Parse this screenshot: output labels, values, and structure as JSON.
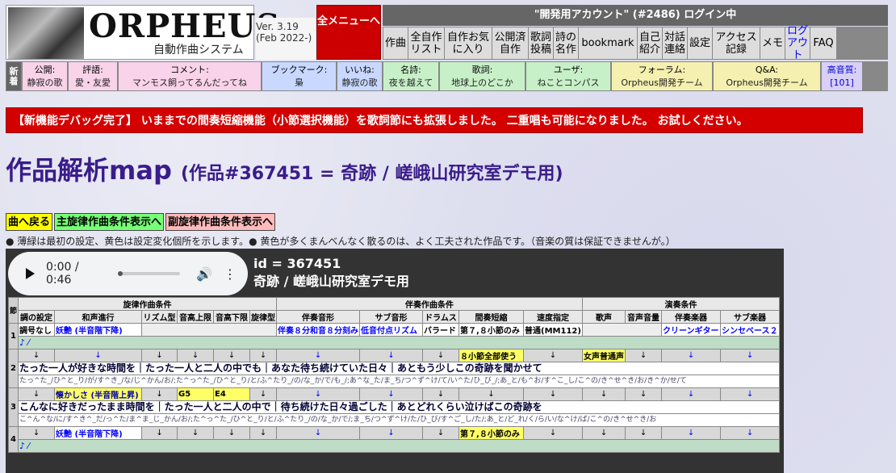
{
  "header": {
    "logo_title": "ORPHEUS",
    "logo_subtitle": "自動作曲システム",
    "version": "Ver. 3.19",
    "version_date": "(Feb 2022-)",
    "all_menu": "全メニューへ",
    "login": "\"開発用アカウント\" (#2486) ログイン中",
    "nav": [
      "作曲",
      "全自作リスト",
      "自作お気に入り",
      "公開済自作",
      "歌詞投稿",
      "詩の名作",
      "bookmark",
      "自己紹介",
      "対話連絡",
      "設定",
      "アクセス記録",
      "メモ",
      "ログアウト",
      "FAQ"
    ]
  },
  "ticker": {
    "new_label": "新着",
    "items": [
      {
        "label": "公開:",
        "value": "静寂の歌",
        "color": "#f9d3e9"
      },
      {
        "label": "評語:",
        "value": "愛・友愛",
        "color": "#f9d3e9"
      },
      {
        "label": "コメント:",
        "value": "マンモス飼ってるんだってね",
        "color": "#f9d3e9"
      },
      {
        "label": "ブックマーク:",
        "value": "梟",
        "color": "#c8d8ff"
      },
      {
        "label": "いいね:",
        "value": "静寂の歌",
        "color": "#c8d8ff"
      },
      {
        "label": "名詩:",
        "value": "夜を越えて",
        "color": "#c8f0c8"
      },
      {
        "label": "歌詞:",
        "value": "地球上のどこか",
        "color": "#c8f0c8"
      },
      {
        "label": "ユーザ:",
        "value": "ねことコンパス",
        "color": "#c8f0c8"
      },
      {
        "label": "フォーラム:",
        "value": "Orpheus開発チーム",
        "color": "#f5f0b0"
      },
      {
        "label": "Q&A:",
        "value": "Orpheus開発チーム",
        "color": "#f5f0b0"
      },
      {
        "label": "高音質:",
        "value": "[101]",
        "color": "#d8d0f8"
      }
    ]
  },
  "banner": "【新機能デバッグ完了】 いままでの間奏短縮機能（小節選択機能）を歌詞節にも拡張しました。 二重唱も可能になりました。 お試しください。",
  "page_title": "作品解析map",
  "page_subtitle": "(作品#367451 = 奇跡 / 嵯峨山研究室デモ用)",
  "buttons": {
    "back": "曲へ戻る",
    "main_cond": "主旋律作曲条件表示へ",
    "sub_cond": "副旋律作曲条件表示へ"
  },
  "note": "● 薄緑は最初の設定、黄色は設定変化個所を示します。● 黄色が多くまんべんなく散るのは、よく工夫された作品です。（音楽の質は保証できませんが。）",
  "audio": {
    "time": "0:00 / 0:46"
  },
  "work": {
    "id_line": "id = 367451",
    "title_line": "奇跡 / 嵯峨山研究室デモ用"
  },
  "table": {
    "section_col": "節",
    "groups": [
      "旋律作曲条件",
      "伴奏作曲条件",
      "演奏条件"
    ],
    "cols": [
      "調の設定",
      "和声進行",
      "リズム型",
      "音高上限",
      "音高下限",
      "旋律型",
      "伴奏音形",
      "サブ音形",
      "ドラムス",
      "間奏短縮",
      "速度指定",
      "歌声",
      "音声音量",
      "伴奏楽器",
      "サブ楽器"
    ],
    "row1": [
      "調号なし",
      "妖艶 (半音階下降)",
      "",
      "",
      "",
      "",
      "伴奏８分和音８分刻み",
      "低音付点リズム",
      "バラード",
      "第７,８小節のみ",
      "普通(MM112)",
      "",
      "",
      "クリーンギター",
      "シンセベース２"
    ],
    "row2_special": {
      "interlude": "８小節全部使う",
      "voice": "女声普通声"
    },
    "row2_lyric": "たった一人が好きな時間を｜たった一人と二人の中でも｜あなた待ち続けていた日々｜あともう少しこの奇跡を聞かせて",
    "row2_kana": "たっ^た_/ひ^と_り/が/す^き_/な/じ^かん/お/;た^っ^た_/ひ^と_り/と/ふ^たり_/の/な_か/で/も_/;あ^な_た/ま_ち/つ^ず^け/て/い^た/ひ_び_/;あ_と/も^お/す^こ_し/こ^の/き^せ^き/お/き^か/せ/て",
    "row3": {
      "harmony": "懐かしさ (半音階上昇)",
      "upper": "G5",
      "lower": "E4"
    },
    "row3_lyric": "こんなに好きだったまま時間を｜たった一人と二人の中で｜待ち続けた日々過ごした｜あとどれくらい泣けばこの奇跡を",
    "row3_kana": "こ^ん^な/に/す^き^_だ/っ^た/ま^ま_じ_かん/お/;た^っ^た_/ひ^と_り/と/ふ^たり_/の/な_か/で/;ま_ち/つ^ず^け/た/ひ_び/す^ご_し/た/;あ_と/ど_れ/く/ら/い/な^け/ば/こ^の/き^せ^き/お",
    "row4": {
      "harmony": "妖艶 (半音階下降)",
      "interlude": "第７,８小節のみ"
    },
    "arrow": "↓",
    "row_nums": [
      "1",
      "2",
      "3",
      "4"
    ]
  }
}
